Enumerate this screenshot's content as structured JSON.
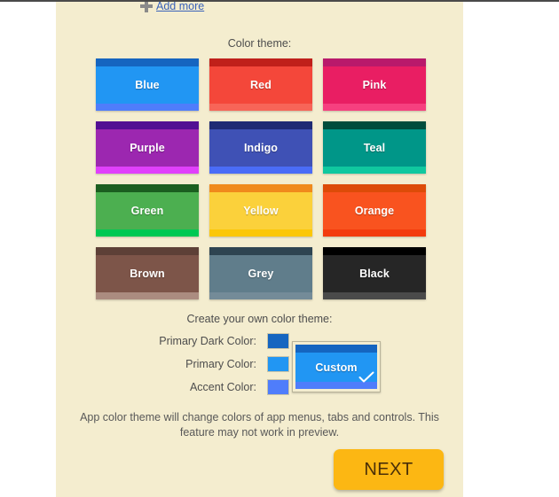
{
  "panel": {
    "background": "#f4edcf"
  },
  "add_more": {
    "label": "Add more",
    "icon": "plus-icon"
  },
  "headings": {
    "color_theme": "Color theme:",
    "custom_theme": "Create your own color theme:"
  },
  "themes": [
    {
      "name": "Blue",
      "dark": "#1565c0",
      "main": "#2196f3",
      "accent": "#4f7dfb"
    },
    {
      "name": "Red",
      "dark": "#c0201a",
      "main": "#f4473a",
      "accent": "#f76558"
    },
    {
      "name": "Pink",
      "dark": "#b9196b",
      "main": "#e91e63",
      "accent": "#f6407f"
    },
    {
      "name": "Purple",
      "dark": "#520f93",
      "main": "#9c27b0",
      "accent": "#e040fb"
    },
    {
      "name": "Indigo",
      "dark": "#1f2a74",
      "main": "#3f51b5",
      "accent": "#4a6cf7"
    },
    {
      "name": "Teal",
      "dark": "#004c3c",
      "main": "#009688",
      "accent": "#10c89f"
    },
    {
      "name": "Green",
      "dark": "#1b5e20",
      "main": "#4caf50",
      "accent": "#00c853"
    },
    {
      "name": "Yellow",
      "dark": "#f08a1c",
      "main": "#fbd13b",
      "accent": "#fbc707"
    },
    {
      "name": "Orange",
      "dark": "#dd4b08",
      "main": "#f9531f",
      "accent": "#f33b0d"
    },
    {
      "name": "Brown",
      "dark": "#5d4037",
      "main": "#7d5549",
      "accent": "#ab8c80"
    },
    {
      "name": "Grey",
      "dark": "#2e4451",
      "main": "#607d8b",
      "accent": "#748b98"
    },
    {
      "name": "Black",
      "dark": "#000000",
      "main": "#262626",
      "accent": "#4a4a4a"
    }
  ],
  "custom_pickers": [
    {
      "label": "Primary Dark Color:",
      "value": "#1565c0"
    },
    {
      "label": "Primary Color:",
      "value": "#2196f3"
    },
    {
      "label": "Accent Color:",
      "value": "#4f7dfb"
    }
  ],
  "custom_swatch": {
    "name": "Custom",
    "dark": "#1565c0",
    "main": "#2196f3",
    "accent": "#4f7dfb",
    "selected": true,
    "check_icon": "check-icon"
  },
  "footer_note": "App color theme will change colors of app menus, tabs and controls. This feature may not work in preview.",
  "next_button": {
    "label": "NEXT",
    "background": "#fcb713",
    "text_color": "#4a2f08"
  }
}
